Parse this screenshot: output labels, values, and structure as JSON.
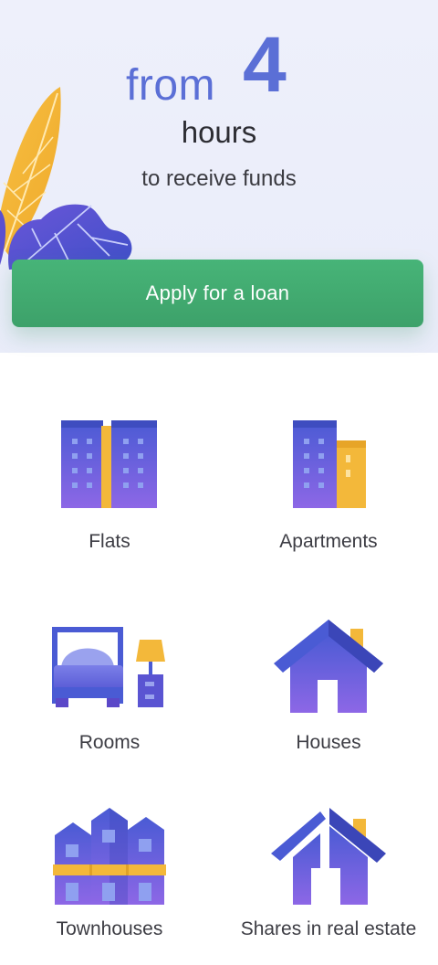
{
  "hero": {
    "from_text": "from",
    "number": "4",
    "unit": "hours",
    "subtitle": "to receive funds",
    "accent_color": "#5b6fd6"
  },
  "cta": {
    "label": "Apply for a loan",
    "color": "#43ad72"
  },
  "categories": [
    {
      "label": "Flats",
      "icon": "flats-building-icon"
    },
    {
      "label": "Apartments",
      "icon": "apartments-building-icon"
    },
    {
      "label": "Rooms",
      "icon": "bed-lamp-icon"
    },
    {
      "label": "Houses",
      "icon": "house-icon"
    },
    {
      "label": "Townhouses",
      "icon": "townhouses-icon"
    },
    {
      "label": "Shares in real estate",
      "icon": "split-house-icon"
    }
  ]
}
